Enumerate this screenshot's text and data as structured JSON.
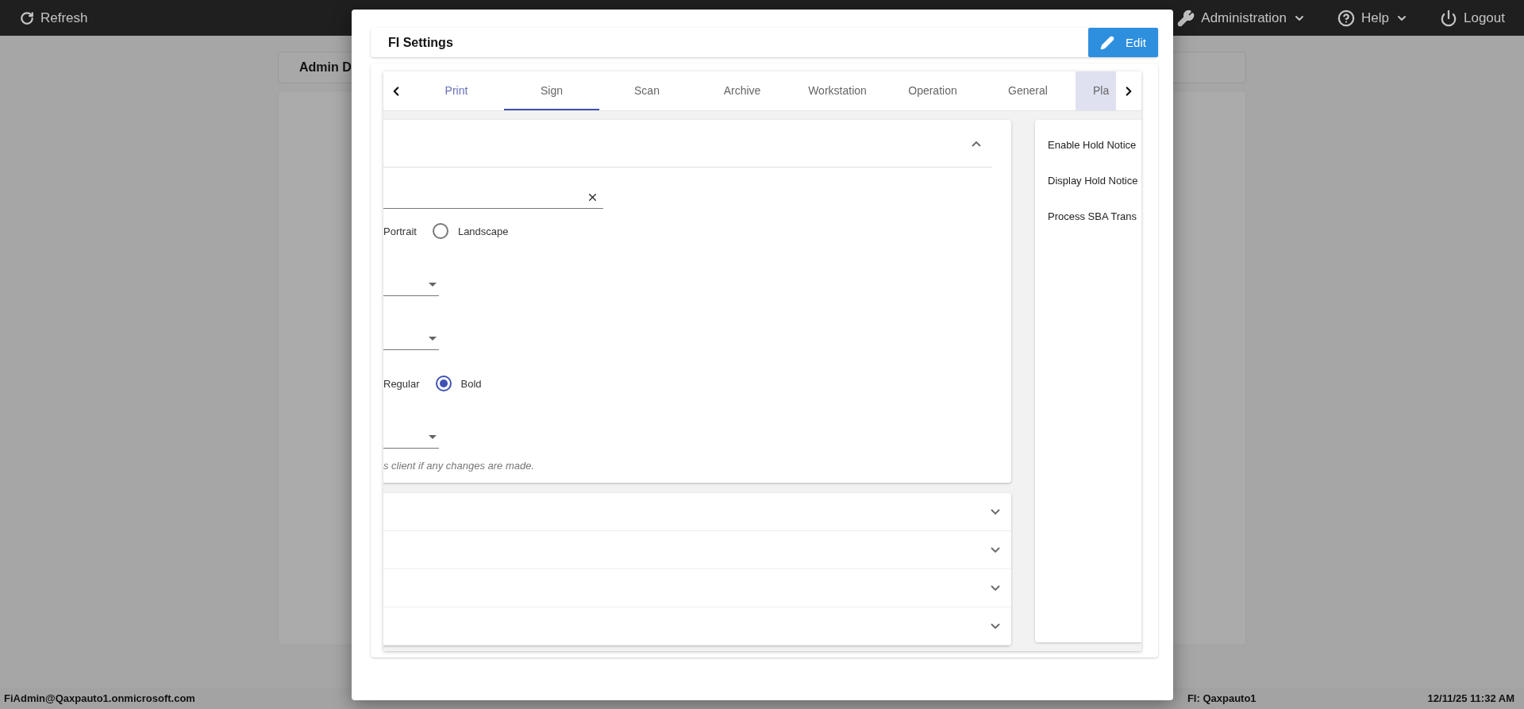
{
  "top_bar": {
    "refresh": "Refresh",
    "menus": [
      {
        "label": "Administration",
        "dropdown": true
      },
      {
        "label": "Help",
        "dropdown": true
      },
      {
        "label": "Logout",
        "dropdown": false
      }
    ]
  },
  "background": {
    "card_title": "Admin D"
  },
  "dialog": {
    "title": "FI Settings",
    "edit_button": "Edit",
    "tabs": [
      {
        "label": "Print",
        "selected": false,
        "hovered": true,
        "focused": false
      },
      {
        "label": "Sign",
        "selected": true,
        "hovered": false,
        "focused": false
      },
      {
        "label": "Scan",
        "selected": false,
        "hovered": false,
        "focused": false
      },
      {
        "label": "Archive",
        "selected": false,
        "hovered": false,
        "focused": false
      },
      {
        "label": "Workstation",
        "selected": false,
        "hovered": false,
        "focused": false
      },
      {
        "label": "Operation",
        "selected": false,
        "hovered": false,
        "focused": false
      },
      {
        "label": "General",
        "selected": false,
        "hovered": false,
        "focused": false
      },
      {
        "label": "Pla",
        "selected": false,
        "hovered": false,
        "focused": true
      }
    ],
    "sign_section": {
      "expanded": true,
      "fields": [
        {
          "kind": "text",
          "clearable": true
        },
        {
          "kind": "radio",
          "options": [
            {
              "label": "Portrait"
            },
            {
              "label": "Landscape",
              "selected": false
            }
          ]
        },
        {
          "kind": "select"
        },
        {
          "kind": "select"
        },
        {
          "kind": "radio",
          "options": [
            {
              "label": "Regular"
            },
            {
              "label": "Bold",
              "selected": true
            }
          ]
        },
        {
          "kind": "select"
        }
      ],
      "note": "s client if any changes are made."
    },
    "collapsed_sections": [
      {
        "expanded": false
      },
      {
        "expanded": false
      },
      {
        "expanded": false
      },
      {
        "expanded": false
      }
    ],
    "side_panel": {
      "items": [
        "Enable Hold Notice",
        "Display Hold Notice",
        "Process SBA Trans"
      ]
    }
  },
  "status_bar": {
    "user": "FiAdmin@Qaxpauto1.onmicrosoft.com",
    "fi": "FI: Qaxpauto1",
    "datetime": "12/11/25 11:32 AM"
  }
}
